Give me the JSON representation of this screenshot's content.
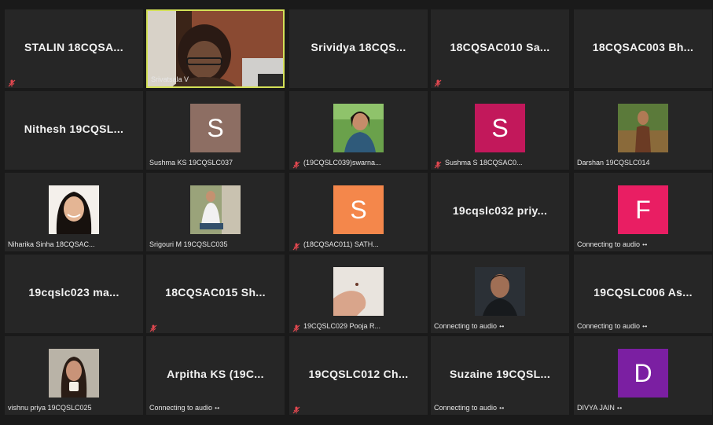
{
  "app": "Microsoft Teams meeting gallery",
  "tiles": [
    {
      "name": "STALIN 18CQSA...",
      "mode": "name",
      "muted": true
    },
    {
      "name": "Srivatsala V",
      "mode": "video",
      "active": true
    },
    {
      "name": "Srividya 18CQS...",
      "mode": "name"
    },
    {
      "name": "18CQSAC010 Sa...",
      "mode": "name",
      "muted": true
    },
    {
      "name": "18CQSAC003 Bh...",
      "mode": "name"
    },
    {
      "name": "Nithesh 19CQSL...",
      "mode": "name"
    },
    {
      "name": "Sushma KS 19CQSLC037",
      "mode": "avatar",
      "initial": "S",
      "color": "#8d6e63"
    },
    {
      "name": "(19CQSLC039)swarna...",
      "mode": "photo",
      "muted": true,
      "photo": "woman-green"
    },
    {
      "name": "Sushma S 18CQSAC0...",
      "mode": "avatar",
      "initial": "S",
      "color": "#c2185b",
      "muted": true
    },
    {
      "name": "Darshan 19CQSLC014",
      "mode": "photo",
      "photo": "man-outdoor"
    },
    {
      "name": "Niharika Sinha 18CQSAC...",
      "mode": "photo",
      "photo": "woman-hair"
    },
    {
      "name": "Srigouri M 19CQSLC035",
      "mode": "photo",
      "photo": "woman-sitting"
    },
    {
      "name": "(18CQSAC011) SATH...",
      "mode": "avatar",
      "initial": "S",
      "color": "#f4874b",
      "muted": true
    },
    {
      "name": "19cqslc032  priy...",
      "mode": "name"
    },
    {
      "name": "Connecting to audio",
      "mode": "avatar",
      "initial": "F",
      "color": "#e91e63",
      "connecting": true
    },
    {
      "name": "19cqslc023  ma...",
      "mode": "name"
    },
    {
      "name": "18CQSAC015  Sh...",
      "mode": "name",
      "muted": true
    },
    {
      "name": "19CQSLC029 Pooja R...",
      "mode": "photo",
      "photo": "hand",
      "muted": true
    },
    {
      "name": "Connecting to audio",
      "mode": "photo",
      "photo": "man-dark",
      "connecting": true
    },
    {
      "name": "19CQSLC006  As...",
      "mode": "name",
      "sub": "Connecting to audio",
      "connecting": true
    },
    {
      "name": "vishnu priya 19CQSLC025",
      "mode": "photo",
      "photo": "girl-cup"
    },
    {
      "name": "Arpitha  KS  (19C...",
      "mode": "name",
      "sub": "Connecting to audio",
      "connecting": true
    },
    {
      "name": "19CQSLC012  Ch...",
      "mode": "name",
      "muted": true
    },
    {
      "name": "Suzaine  19CQSL...",
      "mode": "name",
      "sub": "Connecting to audio",
      "connecting": true
    },
    {
      "name": "DIVYA JAIN",
      "mode": "avatar",
      "initial": "D",
      "color": "#7b1fa2",
      "connecting": true
    }
  ]
}
